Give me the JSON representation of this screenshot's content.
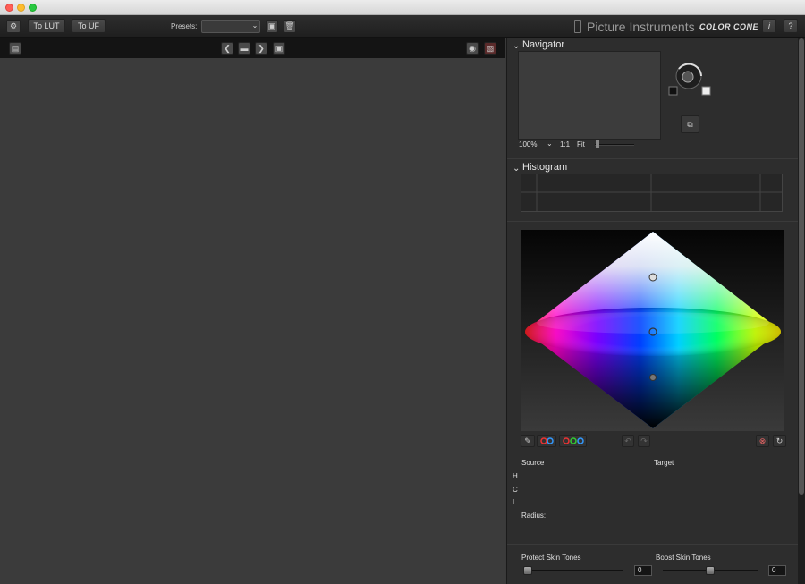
{
  "window": {
    "title": ""
  },
  "toolbar": {
    "to_lut_label": "To LUT",
    "to_uf_label": "To UF",
    "presets_label": "Presets:",
    "presets_value": "",
    "brand_name": "Picture Instruments -",
    "product_name": "COLOR CONE",
    "info_label": "i",
    "help_label": "?"
  },
  "navigator": {
    "title": "Navigator",
    "zoom": "100%",
    "one_to_one": "1:1",
    "fit": "Fit"
  },
  "histogram": {
    "title": "Histogram"
  },
  "cone": {
    "source_label": "Source",
    "target_label": "Target",
    "h_label": "H",
    "c_label": "C",
    "l_label": "L",
    "radius_label": "Radius:"
  },
  "skin": {
    "protect_label": "Protect Skin Tones",
    "protect_value": "0",
    "protect_level": 0,
    "boost_label": "Boost Skin Tones",
    "boost_value": "0",
    "boost_level": 0.5
  },
  "colors": {
    "close": "#ff5f57",
    "minimize": "#febc2e",
    "zoom": "#28c840",
    "panel_bg": "#2d2d2d",
    "viewer_bg": "#3b3b3b"
  }
}
